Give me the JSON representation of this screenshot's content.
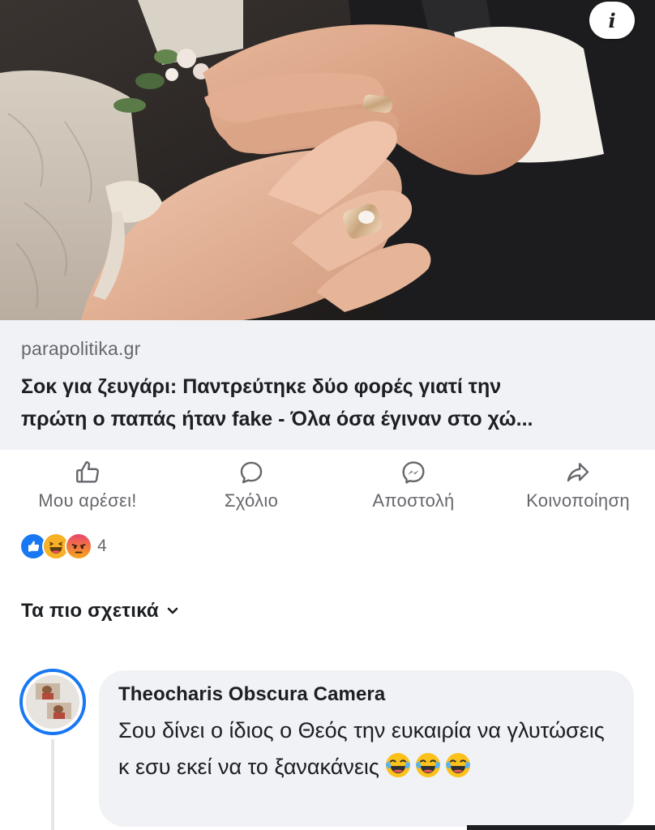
{
  "hero": {
    "info_label": "i",
    "image_subject": "wedding-rings-hands-photo"
  },
  "link_preview": {
    "domain": "parapolitika.gr",
    "title_line1": "Σοκ για ζευγάρι: Παντρεύτηκε δύο φορές γιατί την",
    "title_line2": "πρώτη ο παπάς ήταν fake - Όλα όσα έγιναν στο χώ..."
  },
  "actions": {
    "like": "Μου αρέσει!",
    "comment": "Σχόλιο",
    "send": "Αποστολή",
    "share": "Κοινοποίηση"
  },
  "reactions": {
    "count": "4",
    "types": [
      "like",
      "haha",
      "angry"
    ]
  },
  "sort": {
    "label": "Τα πιο σχετικά"
  },
  "comment": {
    "author": "Theocharis Obscura Camera",
    "text": "Σου δίνει ο ίδιος ο Θεός την ευκαιρία να γλυτώσεις κ εσυ εκεί να το ξανακάνεις",
    "emoji": [
      "tears-of-joy",
      "tears-of-joy",
      "tears-of-joy"
    ]
  },
  "colors": {
    "accent": "#1877f2",
    "link_bg": "#f0f2f5",
    "secondary_text": "#65676b",
    "angry": "#e9710f",
    "haha": "#f7b125"
  }
}
